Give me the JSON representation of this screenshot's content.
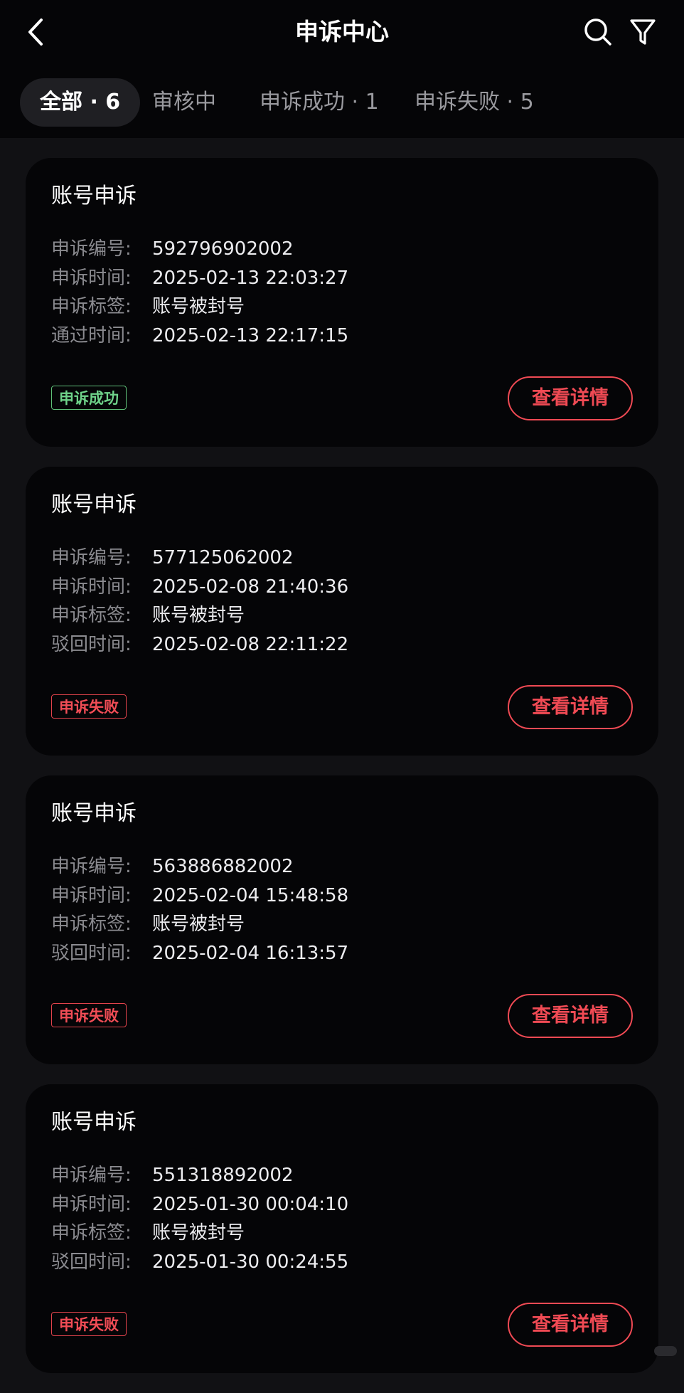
{
  "header": {
    "title": "申诉中心",
    "icons": {
      "back": "chevron-left-icon",
      "search": "search-icon",
      "filter": "filter-icon"
    }
  },
  "tabs": [
    {
      "label": "全部 · 6",
      "active": true
    },
    {
      "label": "审核中",
      "active": false
    },
    {
      "label": "申诉成功 · 1",
      "active": false
    },
    {
      "label": "申诉失败 · 5",
      "active": false
    }
  ],
  "colors": {
    "accent": "#f04a54",
    "success": "#6fd38a",
    "background": "#111114",
    "card": "#050507"
  },
  "cards": [
    {
      "title": "账号申诉",
      "rows": [
        {
          "label": "申诉编号:",
          "value": "592796902002"
        },
        {
          "label": "申诉时间:",
          "value": "2025-02-13 22:03:27"
        },
        {
          "label": "申诉标签:",
          "value": "账号被封号"
        },
        {
          "label": "通过时间:",
          "value": "2025-02-13 22:17:15"
        }
      ],
      "status": "申诉成功",
      "status_type": "success",
      "action": "查看详情"
    },
    {
      "title": "账号申诉",
      "rows": [
        {
          "label": "申诉编号:",
          "value": "577125062002"
        },
        {
          "label": "申诉时间:",
          "value": "2025-02-08 21:40:36"
        },
        {
          "label": "申诉标签:",
          "value": "账号被封号"
        },
        {
          "label": "驳回时间:",
          "value": "2025-02-08 22:11:22"
        }
      ],
      "status": "申诉失败",
      "status_type": "fail",
      "action": "查看详情"
    },
    {
      "title": "账号申诉",
      "rows": [
        {
          "label": "申诉编号:",
          "value": "563886882002"
        },
        {
          "label": "申诉时间:",
          "value": "2025-02-04 15:48:58"
        },
        {
          "label": "申诉标签:",
          "value": "账号被封号"
        },
        {
          "label": "驳回时间:",
          "value": "2025-02-04 16:13:57"
        }
      ],
      "status": "申诉失败",
      "status_type": "fail",
      "action": "查看详情"
    },
    {
      "title": "账号申诉",
      "rows": [
        {
          "label": "申诉编号:",
          "value": "551318892002"
        },
        {
          "label": "申诉时间:",
          "value": "2025-01-30 00:04:10"
        },
        {
          "label": "申诉标签:",
          "value": "账号被封号"
        },
        {
          "label": "驳回时间:",
          "value": "2025-01-30 00:24:55"
        }
      ],
      "status": "申诉失败",
      "status_type": "fail",
      "action": "查看详情"
    }
  ]
}
